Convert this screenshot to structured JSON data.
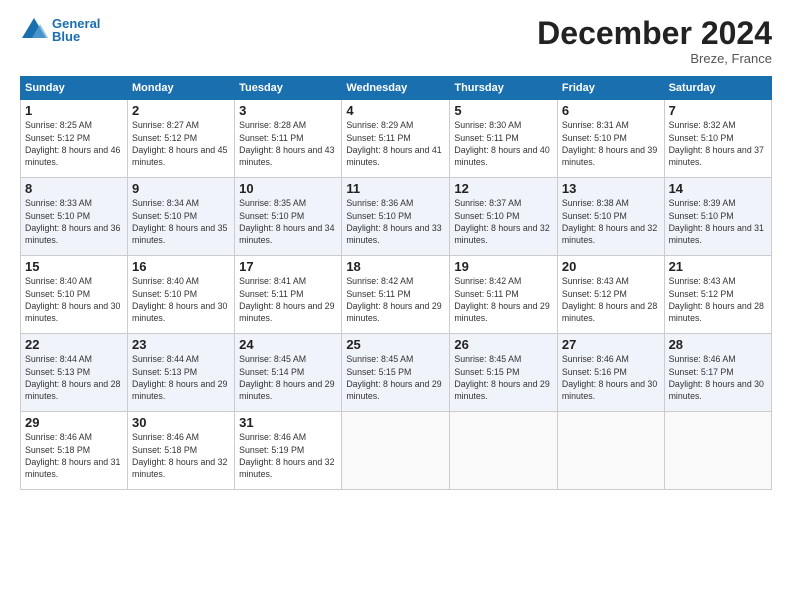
{
  "header": {
    "logo_line1": "General",
    "logo_line2": "Blue",
    "month_title": "December 2024",
    "location": "Breze, France"
  },
  "days_of_week": [
    "Sunday",
    "Monday",
    "Tuesday",
    "Wednesday",
    "Thursday",
    "Friday",
    "Saturday"
  ],
  "weeks": [
    [
      {
        "day": "1",
        "sunrise": "Sunrise: 8:25 AM",
        "sunset": "Sunset: 5:12 PM",
        "daylight": "Daylight: 8 hours and 46 minutes."
      },
      {
        "day": "2",
        "sunrise": "Sunrise: 8:27 AM",
        "sunset": "Sunset: 5:12 PM",
        "daylight": "Daylight: 8 hours and 45 minutes."
      },
      {
        "day": "3",
        "sunrise": "Sunrise: 8:28 AM",
        "sunset": "Sunset: 5:11 PM",
        "daylight": "Daylight: 8 hours and 43 minutes."
      },
      {
        "day": "4",
        "sunrise": "Sunrise: 8:29 AM",
        "sunset": "Sunset: 5:11 PM",
        "daylight": "Daylight: 8 hours and 41 minutes."
      },
      {
        "day": "5",
        "sunrise": "Sunrise: 8:30 AM",
        "sunset": "Sunset: 5:11 PM",
        "daylight": "Daylight: 8 hours and 40 minutes."
      },
      {
        "day": "6",
        "sunrise": "Sunrise: 8:31 AM",
        "sunset": "Sunset: 5:10 PM",
        "daylight": "Daylight: 8 hours and 39 minutes."
      },
      {
        "day": "7",
        "sunrise": "Sunrise: 8:32 AM",
        "sunset": "Sunset: 5:10 PM",
        "daylight": "Daylight: 8 hours and 37 minutes."
      }
    ],
    [
      {
        "day": "8",
        "sunrise": "Sunrise: 8:33 AM",
        "sunset": "Sunset: 5:10 PM",
        "daylight": "Daylight: 8 hours and 36 minutes."
      },
      {
        "day": "9",
        "sunrise": "Sunrise: 8:34 AM",
        "sunset": "Sunset: 5:10 PM",
        "daylight": "Daylight: 8 hours and 35 minutes."
      },
      {
        "day": "10",
        "sunrise": "Sunrise: 8:35 AM",
        "sunset": "Sunset: 5:10 PM",
        "daylight": "Daylight: 8 hours and 34 minutes."
      },
      {
        "day": "11",
        "sunrise": "Sunrise: 8:36 AM",
        "sunset": "Sunset: 5:10 PM",
        "daylight": "Daylight: 8 hours and 33 minutes."
      },
      {
        "day": "12",
        "sunrise": "Sunrise: 8:37 AM",
        "sunset": "Sunset: 5:10 PM",
        "daylight": "Daylight: 8 hours and 32 minutes."
      },
      {
        "day": "13",
        "sunrise": "Sunrise: 8:38 AM",
        "sunset": "Sunset: 5:10 PM",
        "daylight": "Daylight: 8 hours and 32 minutes."
      },
      {
        "day": "14",
        "sunrise": "Sunrise: 8:39 AM",
        "sunset": "Sunset: 5:10 PM",
        "daylight": "Daylight: 8 hours and 31 minutes."
      }
    ],
    [
      {
        "day": "15",
        "sunrise": "Sunrise: 8:40 AM",
        "sunset": "Sunset: 5:10 PM",
        "daylight": "Daylight: 8 hours and 30 minutes."
      },
      {
        "day": "16",
        "sunrise": "Sunrise: 8:40 AM",
        "sunset": "Sunset: 5:10 PM",
        "daylight": "Daylight: 8 hours and 30 minutes."
      },
      {
        "day": "17",
        "sunrise": "Sunrise: 8:41 AM",
        "sunset": "Sunset: 5:11 PM",
        "daylight": "Daylight: 8 hours and 29 minutes."
      },
      {
        "day": "18",
        "sunrise": "Sunrise: 8:42 AM",
        "sunset": "Sunset: 5:11 PM",
        "daylight": "Daylight: 8 hours and 29 minutes."
      },
      {
        "day": "19",
        "sunrise": "Sunrise: 8:42 AM",
        "sunset": "Sunset: 5:11 PM",
        "daylight": "Daylight: 8 hours and 29 minutes."
      },
      {
        "day": "20",
        "sunrise": "Sunrise: 8:43 AM",
        "sunset": "Sunset: 5:12 PM",
        "daylight": "Daylight: 8 hours and 28 minutes."
      },
      {
        "day": "21",
        "sunrise": "Sunrise: 8:43 AM",
        "sunset": "Sunset: 5:12 PM",
        "daylight": "Daylight: 8 hours and 28 minutes."
      }
    ],
    [
      {
        "day": "22",
        "sunrise": "Sunrise: 8:44 AM",
        "sunset": "Sunset: 5:13 PM",
        "daylight": "Daylight: 8 hours and 28 minutes."
      },
      {
        "day": "23",
        "sunrise": "Sunrise: 8:44 AM",
        "sunset": "Sunset: 5:13 PM",
        "daylight": "Daylight: 8 hours and 29 minutes."
      },
      {
        "day": "24",
        "sunrise": "Sunrise: 8:45 AM",
        "sunset": "Sunset: 5:14 PM",
        "daylight": "Daylight: 8 hours and 29 minutes."
      },
      {
        "day": "25",
        "sunrise": "Sunrise: 8:45 AM",
        "sunset": "Sunset: 5:15 PM",
        "daylight": "Daylight: 8 hours and 29 minutes."
      },
      {
        "day": "26",
        "sunrise": "Sunrise: 8:45 AM",
        "sunset": "Sunset: 5:15 PM",
        "daylight": "Daylight: 8 hours and 29 minutes."
      },
      {
        "day": "27",
        "sunrise": "Sunrise: 8:46 AM",
        "sunset": "Sunset: 5:16 PM",
        "daylight": "Daylight: 8 hours and 30 minutes."
      },
      {
        "day": "28",
        "sunrise": "Sunrise: 8:46 AM",
        "sunset": "Sunset: 5:17 PM",
        "daylight": "Daylight: 8 hours and 30 minutes."
      }
    ],
    [
      {
        "day": "29",
        "sunrise": "Sunrise: 8:46 AM",
        "sunset": "Sunset: 5:18 PM",
        "daylight": "Daylight: 8 hours and 31 minutes."
      },
      {
        "day": "30",
        "sunrise": "Sunrise: 8:46 AM",
        "sunset": "Sunset: 5:18 PM",
        "daylight": "Daylight: 8 hours and 32 minutes."
      },
      {
        "day": "31",
        "sunrise": "Sunrise: 8:46 AM",
        "sunset": "Sunset: 5:19 PM",
        "daylight": "Daylight: 8 hours and 32 minutes."
      },
      null,
      null,
      null,
      null
    ]
  ]
}
